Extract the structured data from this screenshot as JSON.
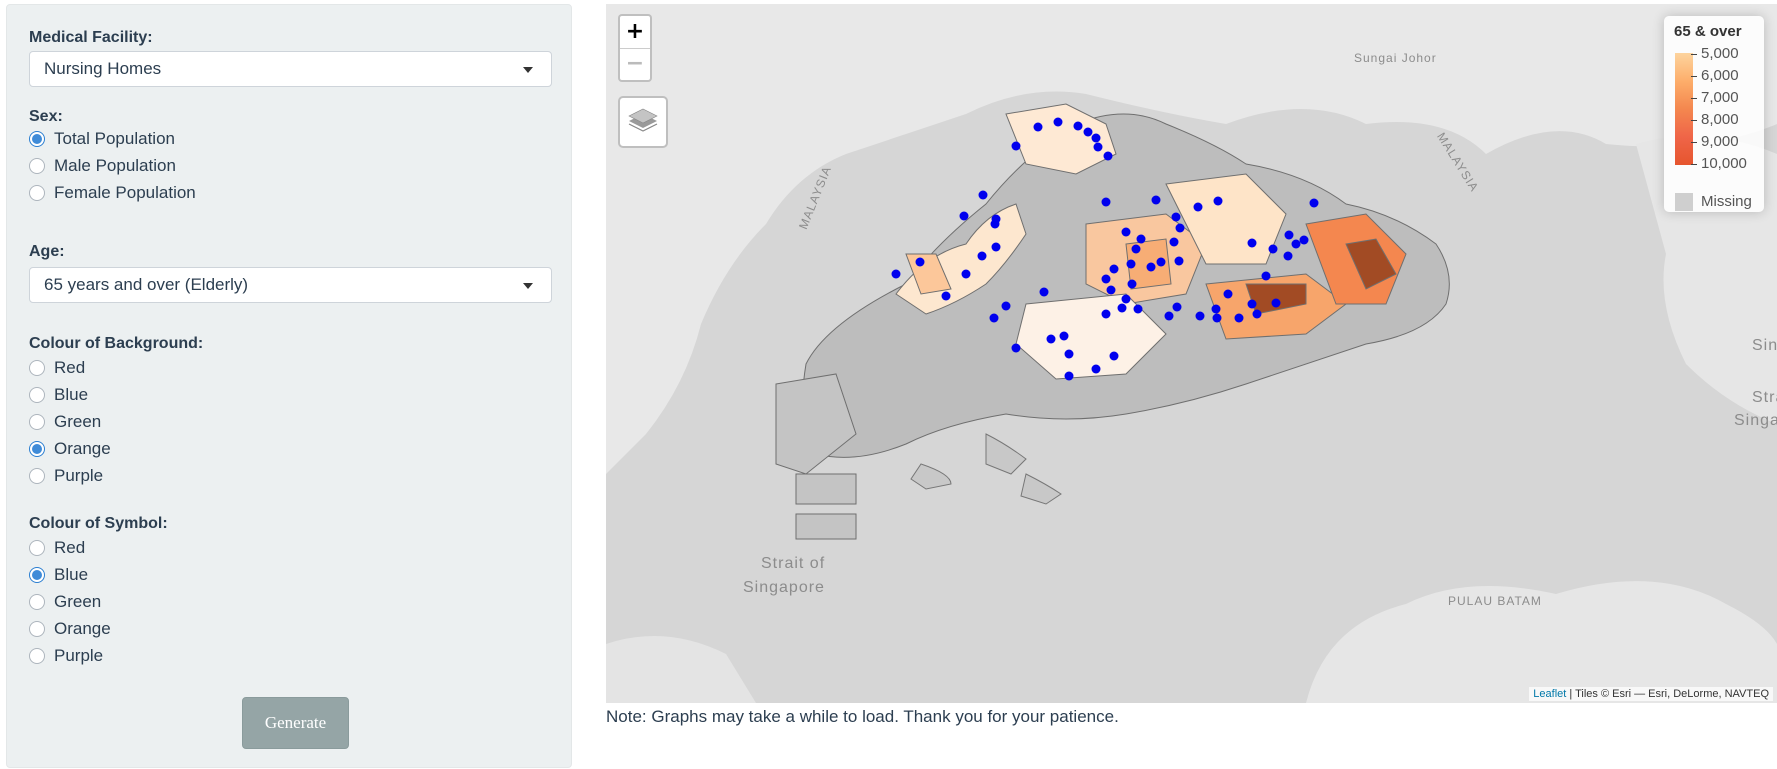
{
  "sidebar": {
    "facility": {
      "label": "Medical Facility:",
      "value": "Nursing Homes"
    },
    "sex": {
      "label": "Sex:",
      "options": [
        "Total Population",
        "Male Population",
        "Female Population"
      ],
      "selected": "Total Population"
    },
    "age": {
      "label": "Age:",
      "value": "65 years and over (Elderly)"
    },
    "background": {
      "label": "Colour of Background:",
      "options": [
        "Red",
        "Blue",
        "Green",
        "Orange",
        "Purple"
      ],
      "selected": "Orange"
    },
    "symbol": {
      "label": "Colour of Symbol:",
      "options": [
        "Red",
        "Blue",
        "Green",
        "Orange",
        "Purple"
      ],
      "selected": "Blue"
    },
    "generate_label": "Generate"
  },
  "map": {
    "zoom_in": "+",
    "zoom_out": "−",
    "legend": {
      "title": "65 & over",
      "values": [
        "5,000",
        "6,000",
        "7,000",
        "8,000",
        "9,000",
        "10,000"
      ],
      "missing": "Missing",
      "gradient": [
        "#fdd49e",
        "#fdae6b",
        "#f4874f",
        "#ef6548",
        "#e6552e"
      ],
      "missing_color": "#cfcfcf"
    },
    "labels": {
      "sungai_johor": "Sungai Johor",
      "malaysia_left": "MALAYSIA",
      "malaysia_right": "MALAYSIA",
      "strait_line1": "Strait of",
      "strait_line2": "Singapore",
      "pulau_batam": "PULAU BATAM",
      "right_sin": "Sin",
      "right_strait": "Strait",
      "right_singap": "Singap"
    },
    "attribution": {
      "link": "Leaflet",
      "text": " | Tiles © Esri — Esri, DeLorme, NAVTEQ"
    },
    "symbol_color": "#0000ee"
  },
  "note": "Note: Graphs may take a while to load. Thank you for your patience."
}
